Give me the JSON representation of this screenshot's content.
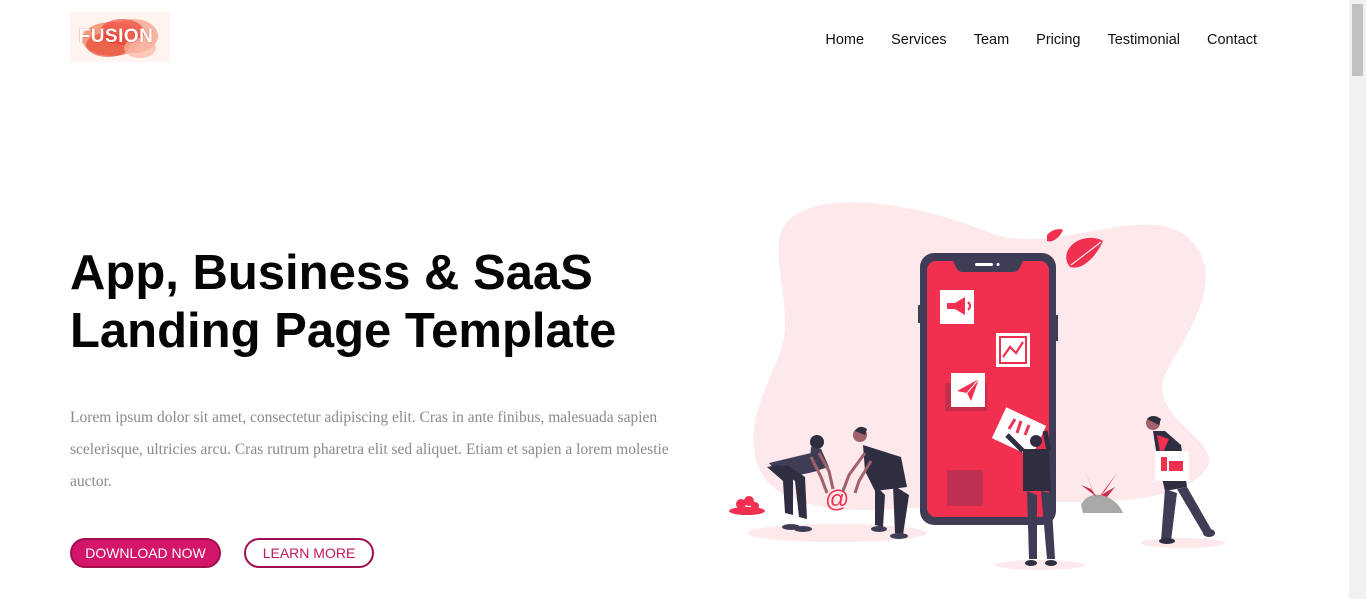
{
  "brand": {
    "logo_text": "FUSION"
  },
  "nav": {
    "items": [
      "Home",
      "Services",
      "Team",
      "Pricing",
      "Testimonial",
      "Contact"
    ]
  },
  "hero": {
    "title_line1": "App, Business & SaaS",
    "title_line2": "Landing Page Template",
    "description": "Lorem ipsum dolor sit amet, consectetur adipiscing elit. Cras in ante finibus, malesuada sapien scelerisque, ultricies arcu. Cras rutrum pharetra elit sed aliquet. Etiam et sapien a lorem molestie auctor.",
    "primary_button": "DOWNLOAD NOW",
    "secondary_button": "LEARN MORE"
  },
  "illustration": {
    "at_symbol": "@"
  },
  "colors": {
    "accent": "#d4166a",
    "phone_screen": "#f1304f",
    "phone_frame": "#3f3d56",
    "blob": "#fde8ec"
  }
}
